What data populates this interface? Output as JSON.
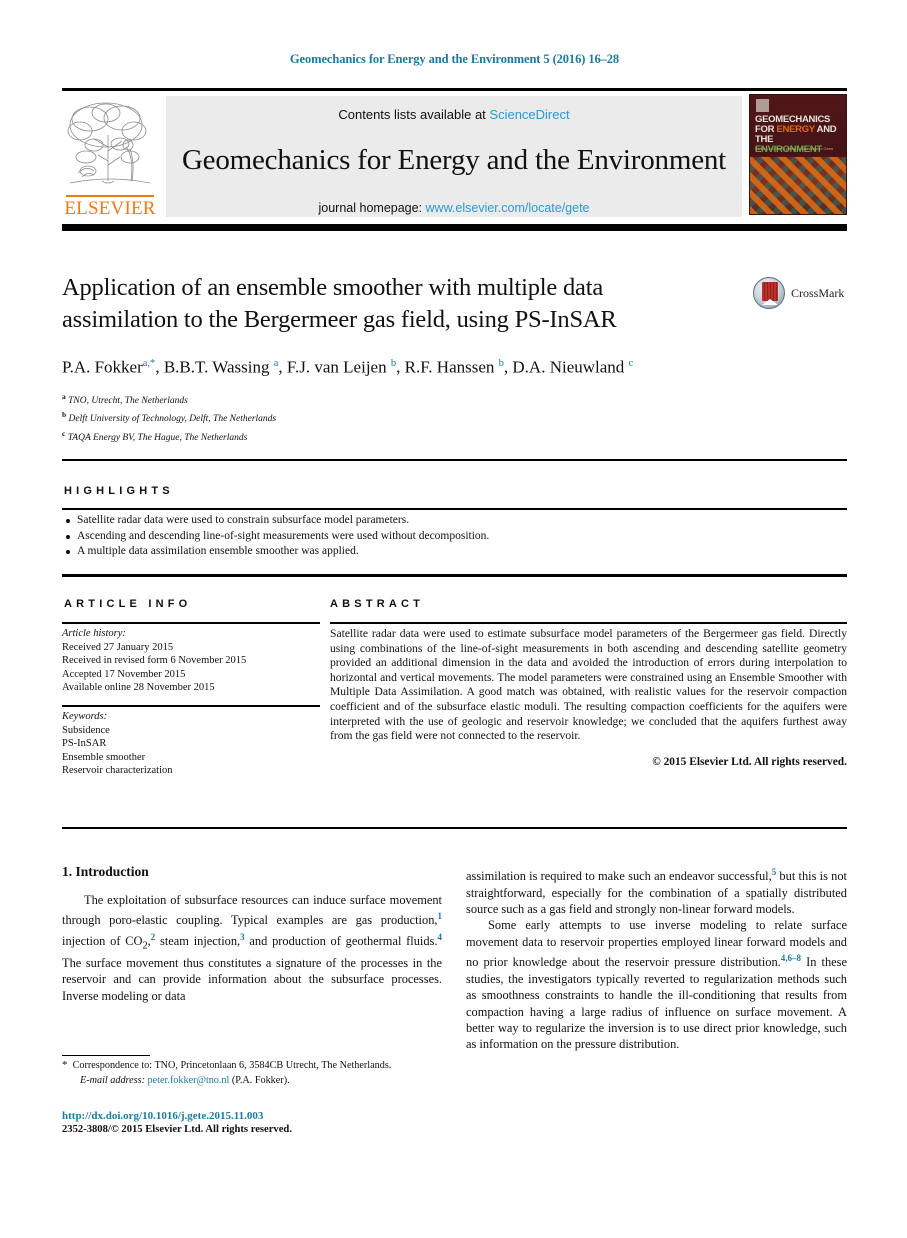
{
  "running_head": "Geomechanics for Energy and the Environment 5 (2016) 16–28",
  "masthead": {
    "publisher_name": "ELSEVIER",
    "contents_prefix": "Contents lists available at ",
    "contents_link": "ScienceDirect",
    "journal_title": "Geomechanics for Energy and the Environment",
    "homepage_prefix": "journal homepage: ",
    "homepage_link": "www.elsevier.com/locate/gete",
    "cover": {
      "line1": "GEOMECHANICS",
      "line2_a": "FOR ",
      "line2_b": "ENERGY",
      "line2_c": " AND THE",
      "line3": "ENVIRONMENT",
      "editors": "Editors-in-Chief\nLyesse Laloui   Antonio Gens"
    }
  },
  "article": {
    "title": "Application of an ensemble smoother with multiple data assimilation to the Bergermeer gas field, using PS-InSAR",
    "authors_html": "P.A. Fokker<sup>a,*</sup>, B.B.T. Wassing <sup>a</sup>, F.J. van Leijen <sup>b</sup>, R.F. Hanssen <sup>b</sup>, D.A. Nieuwland <sup>c</sup>",
    "affiliations": [
      {
        "marker": "a",
        "text": "TNO, Utrecht, The Netherlands"
      },
      {
        "marker": "b",
        "text": "Delft University of Technology, Delft, The Netherlands"
      },
      {
        "marker": "c",
        "text": "TAQA Energy BV, The Hague, The Netherlands"
      }
    ],
    "crossmark_label": "CrossMark"
  },
  "highlights": {
    "heading": "HIGHLIGHTS",
    "items": [
      "Satellite radar data were used to constrain subsurface model parameters.",
      "Ascending and descending line-of-sight measurements were used without decomposition.",
      "A multiple data assimilation ensemble smoother was applied."
    ]
  },
  "article_info": {
    "heading": "ARTICLE INFO",
    "history_label": "Article history:",
    "history": [
      "Received 27 January 2015",
      "Received in revised form 6 November 2015",
      "Accepted 17 November 2015",
      "Available online 28 November 2015"
    ],
    "keywords_label": "Keywords:",
    "keywords": [
      "Subsidence",
      "PS-InSAR",
      "Ensemble smoother",
      "Reservoir characterization"
    ]
  },
  "abstract": {
    "heading": "ABSTRACT",
    "text": "Satellite radar data were used to estimate subsurface model parameters of the Bergermeer gas field. Directly using combinations of the line-of-sight measurements in both ascending and descending satellite geometry provided an additional dimension in the data and avoided the introduction of errors during interpolation to horizontal and vertical movements. The model parameters were constrained using an Ensemble Smoother with Multiple Data Assimilation. A good match was obtained, with realistic values for the reservoir compaction coefficient and of the subsurface elastic moduli. The resulting compaction coefficients for the aquifers were interpreted with the use of geologic and reservoir knowledge; we concluded that the aquifers furthest away from the gas field were not connected to the reservoir.",
    "copyright": "© 2015 Elsevier Ltd. All rights reserved."
  },
  "body": {
    "section_number_title": "1. Introduction",
    "left_paragraph_html": "The exploitation of subsurface resources can induce surface movement through poro-elastic coupling. Typical examples are gas production,<sup>1</sup> injection of CO<sub>2</sub>,<sup>2</sup> steam injection,<sup>3</sup> and production of geothermal fluids.<sup>4</sup> The surface movement thus constitutes a signature of the processes in the reservoir and can provide information about the subsurface processes. Inverse modeling or data",
    "right_paragraph_1_html": "assimilation is required to make such an endeavor successful,<sup>5</sup> but this is not straightforward, especially for the combination of a spatially distributed source such as a gas field and strongly non-linear forward models.",
    "right_paragraph_2_html": "Some early attempts to use inverse modeling to relate surface movement data to reservoir properties employed linear forward models and no prior knowledge about the reservoir pressure distribution.<sup>4,6–8</sup> In these studies, the investigators typically reverted to regularization methods such as smoothness constraints to handle the ill-conditioning that results from compaction having a large radius of influence on surface movement. A better way to regularize the inversion is to use direct prior knowledge, such as information on the pressure distribution."
  },
  "footer": {
    "correspondence_html": "<span class=\"fn-star\">*</span>&nbsp; Correspondence to: TNO, Princetonlaan 6, 3584CB Utrecht, The Netherlands.",
    "email_label": "E-mail address:",
    "email": "peter.fokker@tno.nl",
    "email_suffix": "(P.A. Fokker).",
    "doi": "http://dx.doi.org/10.1016/j.gete.2015.11.003",
    "issn_copyright": "2352-3808/© 2015 Elsevier Ltd. All rights reserved."
  },
  "colors": {
    "link_blue": "#2a9ad4",
    "teal_header": "#1b7a9e",
    "elsevier_orange": "#f07a13",
    "cover_maroon": "#4d1516"
  }
}
